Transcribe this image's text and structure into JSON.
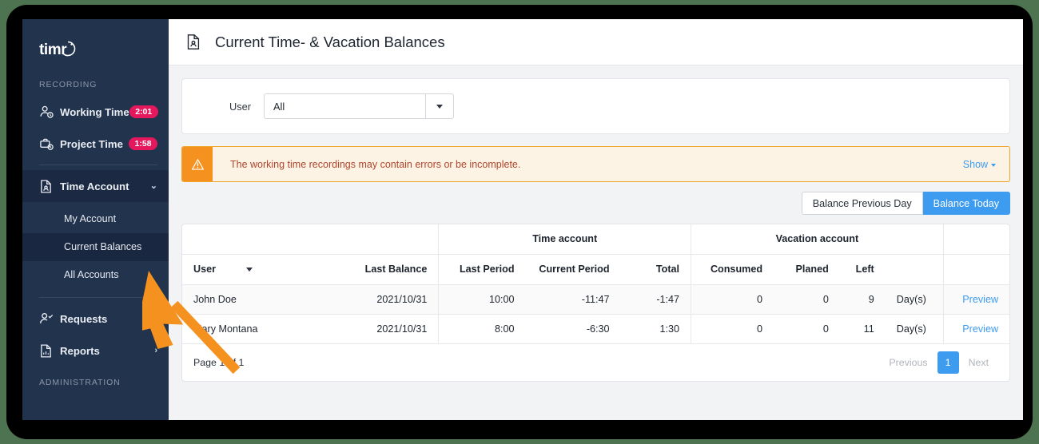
{
  "brand": {
    "logo_text": "timr",
    "accent": "#3d9bf0",
    "sidebar_bg": "#22334d",
    "badge_bg": "#e5185e"
  },
  "sidebar": {
    "sections": [
      {
        "title": "RECORDING"
      },
      {
        "title": "ADMINISTRATION"
      }
    ],
    "recording_label": "RECORDING",
    "administration_label": "ADMINISTRATION",
    "items": [
      {
        "label": "Working Time",
        "icon": "user-clock-icon",
        "badge": "2:01"
      },
      {
        "label": "Project Time",
        "icon": "briefcase-clock-icon",
        "badge": "1:58"
      },
      {
        "label": "Time Account",
        "icon": "document-person-icon",
        "chevron": "⌄"
      },
      {
        "label": "Requests",
        "icon": "user-check-icon",
        "chevron": "›"
      },
      {
        "label": "Reports",
        "icon": "document-chart-icon",
        "chevron": "›"
      }
    ],
    "sub_items": [
      {
        "label": "My Account"
      },
      {
        "label": "Current Balances"
      },
      {
        "label": "All Accounts"
      }
    ]
  },
  "header": {
    "icon": "document-person-icon",
    "title": "Current Time- & Vacation Balances"
  },
  "filter": {
    "user_label": "User",
    "user_value": "All",
    "dropdown_icon": "chevron-down-icon"
  },
  "alert": {
    "icon": "warning-triangle-icon",
    "message": "The working time recordings may contain errors or be incomplete.",
    "show_label": "Show",
    "bg": "#fdf3e4",
    "icon_bg": "#f5911e",
    "text_color": "#b0462c"
  },
  "toggles": {
    "options": [
      {
        "label": "Balance Previous Day",
        "active": false
      },
      {
        "label": "Balance Today",
        "active": true
      }
    ]
  },
  "table": {
    "group_headers": [
      {
        "label": "",
        "span": 2
      },
      {
        "label": "Time account",
        "span": 3
      },
      {
        "label": "Vacation account",
        "span": 4
      },
      {
        "label": "",
        "span": 1
      }
    ],
    "columns": [
      {
        "label": "User",
        "align": "left",
        "sortable": true
      },
      {
        "label": "Last Balance",
        "align": "right"
      },
      {
        "label": "Last Period",
        "align": "right"
      },
      {
        "label": "Current Period",
        "align": "right"
      },
      {
        "label": "Total",
        "align": "right"
      },
      {
        "label": "Consumed",
        "align": "right"
      },
      {
        "label": "Planed",
        "align": "right"
      },
      {
        "label": "Left",
        "align": "right"
      },
      {
        "label": "",
        "align": "left"
      },
      {
        "label": "",
        "align": "right"
      }
    ],
    "rows": [
      {
        "user": "John Doe",
        "last_balance": "2021/10/31",
        "last_period": "10:00",
        "current_period": "-11:47",
        "total": "-1:47",
        "consumed": "0",
        "planed": "0",
        "left": "9",
        "unit": "Day(s)",
        "action": "Preview"
      },
      {
        "user": "Mary Montana",
        "last_balance": "2021/10/31",
        "last_period": "8:00",
        "current_period": "-6:30",
        "total": "1:30",
        "consumed": "0",
        "planed": "0",
        "left": "11",
        "unit": "Day(s)",
        "action": "Preview"
      }
    ]
  },
  "pagination": {
    "info": "Page 1 of 1",
    "previous_label": "Previous",
    "current_page": "1",
    "next_label": "Next"
  },
  "cursor": {
    "icon": "arrow-pointer",
    "color": "#f5911e"
  }
}
